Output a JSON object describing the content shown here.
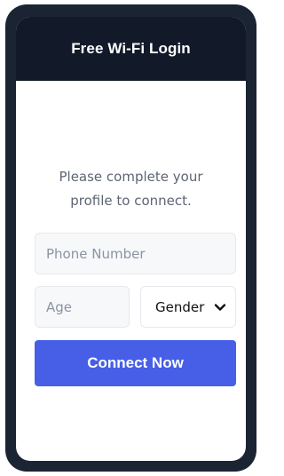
{
  "header": {
    "title": "Free Wi-Fi Login"
  },
  "prompt": {
    "line1": "Please complete your",
    "line2": "profile to connect."
  },
  "form": {
    "phone": {
      "placeholder": "Phone Number",
      "value": ""
    },
    "age": {
      "placeholder": "Age",
      "value": ""
    },
    "gender": {
      "selected": "Gender",
      "icon": "chevron-down-icon"
    },
    "connect_label": "Connect Now"
  },
  "colors": {
    "device_frame": "#1b2433",
    "header_bg": "#121a2a",
    "primary": "#465fe6",
    "prompt_text": "#5d6573",
    "field_bg": "#f7f8fa"
  }
}
